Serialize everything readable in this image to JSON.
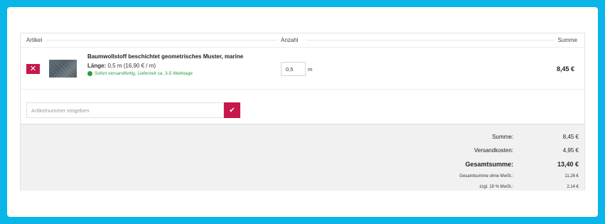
{
  "table": {
    "col_artikel": "Artikel",
    "col_anzahl": "Anzahl",
    "col_summe": "Summe"
  },
  "item": {
    "remove_icon": "close-icon",
    "name": "Baumwollstoff beschichtet geometrisches Muster, marine",
    "length_label": "Länge:",
    "length_value": "0,5 m (16,90 € / m)",
    "availability": "Sofort versandfertig, Lieferzeit ca. 3-5 Werktage",
    "availability_color": "#2a9a3b",
    "quantity": "0,5",
    "unit": "m",
    "sum": "8,45 €"
  },
  "add_article": {
    "placeholder": "Artikelnummer eingeben",
    "button_icon": "check-icon"
  },
  "totals": {
    "summe_label": "Summe:",
    "summe_value": "8,45 €",
    "versand_label": "Versandkosten:",
    "versand_value": "4,95 €",
    "gesamt_label": "Gesamtsumme:",
    "gesamt_value": "13,40 €",
    "netto_label": "Gesamtsumme ohne MwSt.:",
    "netto_value": "11,26 €",
    "mwst_label": "zzgl. 19 % MwSt.:",
    "mwst_value": "2,14 €"
  },
  "colors": {
    "accent": "#c8174b",
    "frame": "#0ab5e8"
  }
}
